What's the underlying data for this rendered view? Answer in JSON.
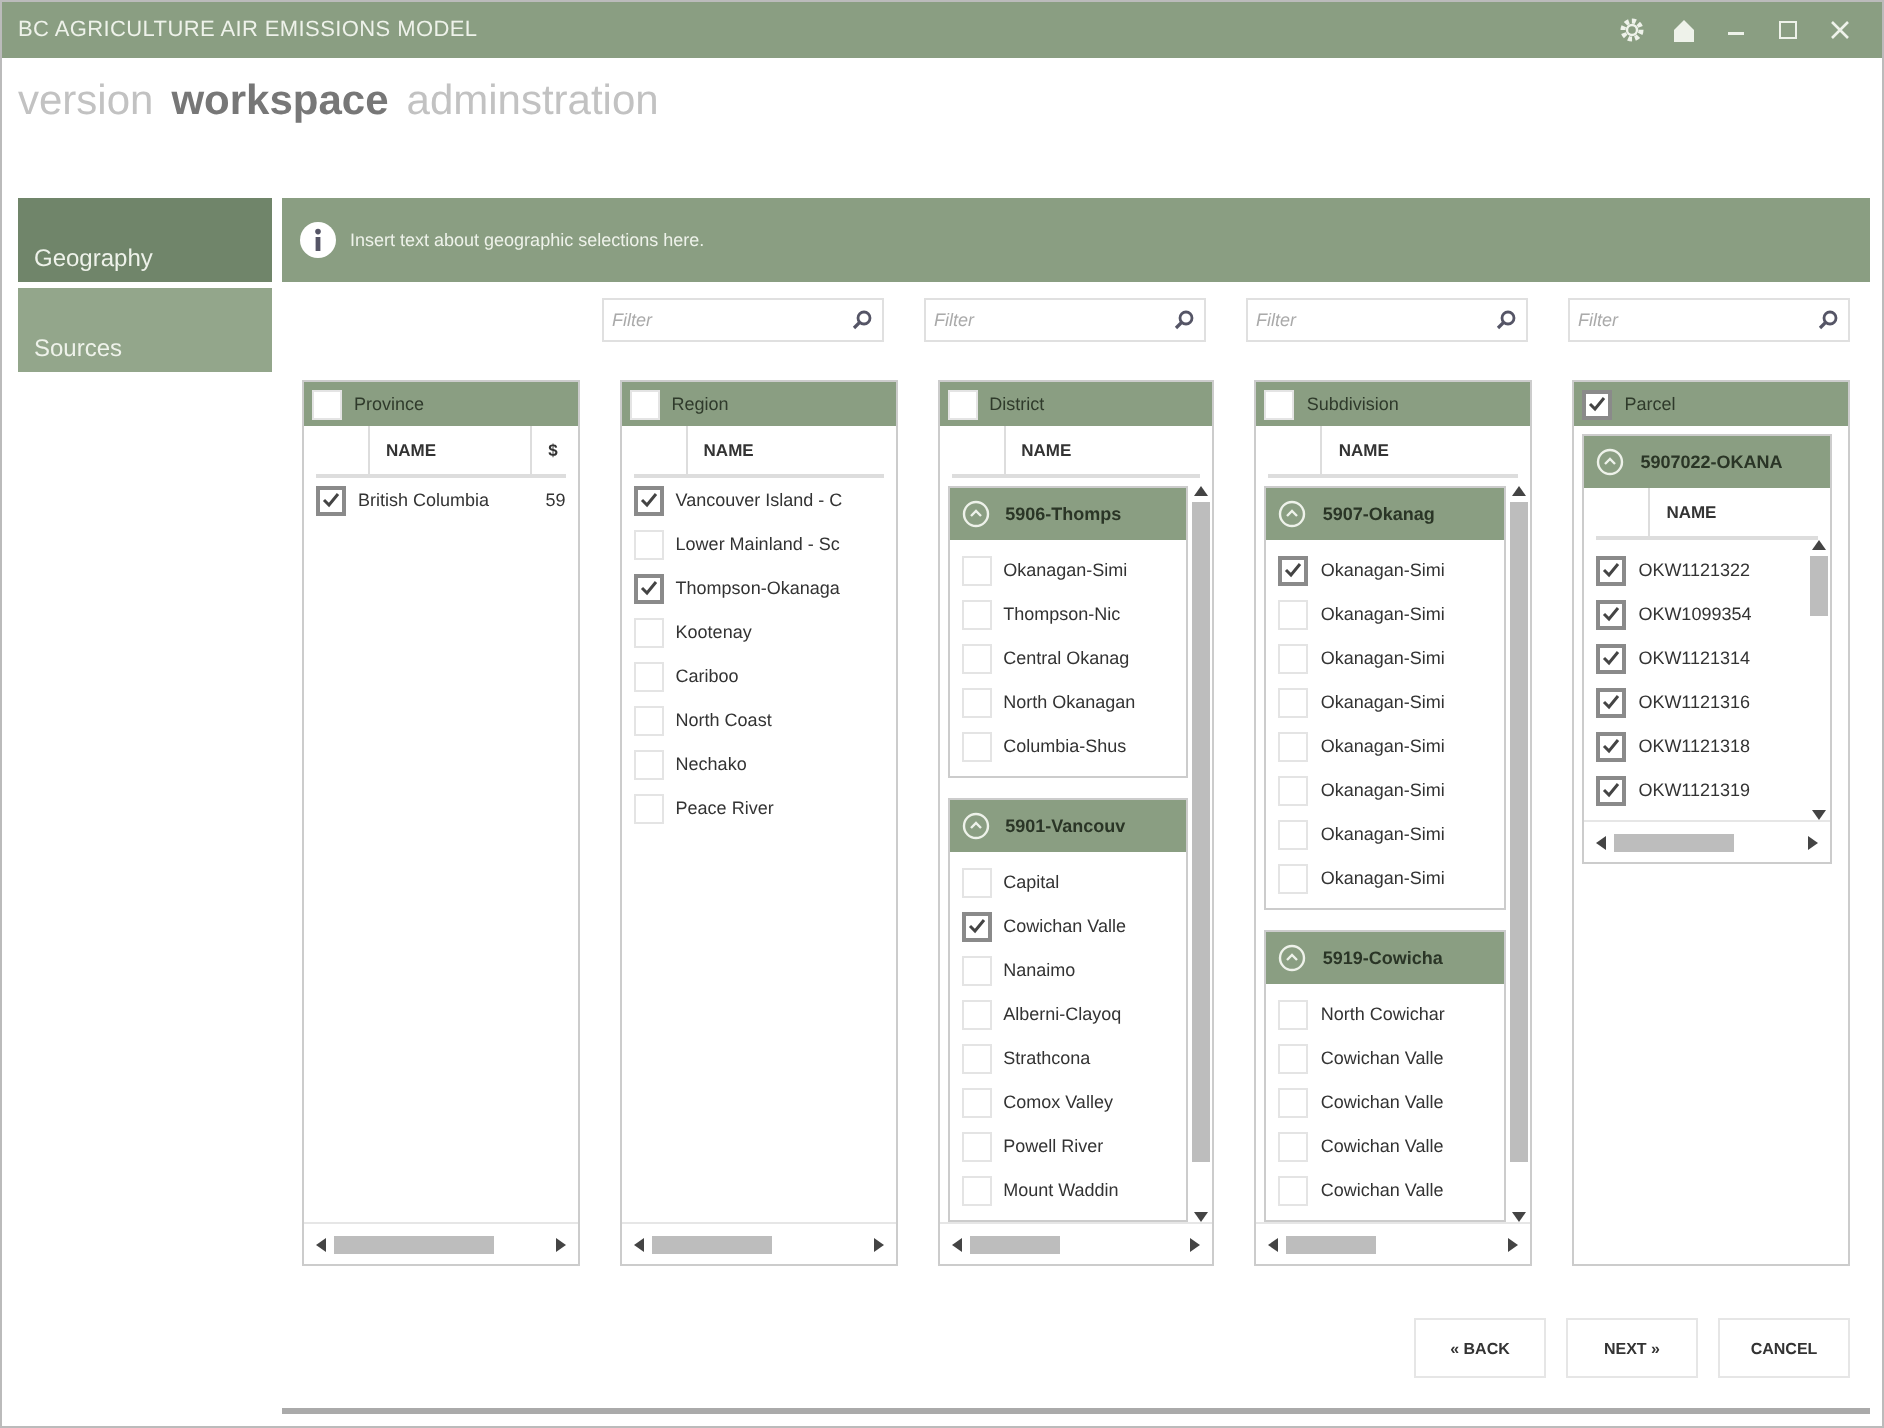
{
  "window": {
    "title": "BC AGRICULTURE AIR EMISSIONS MODEL"
  },
  "nav": [
    {
      "label": "version",
      "selected": false
    },
    {
      "label": "workspace",
      "selected": true
    },
    {
      "label": "adminstration",
      "selected": false
    }
  ],
  "sidebar": {
    "items": [
      {
        "label": "Geography",
        "selected": true
      },
      {
        "label": "Sources",
        "selected": false
      }
    ]
  },
  "info": {
    "text": "Insert text about geographic selections here."
  },
  "columns": [
    {
      "kind": "flat",
      "header": {
        "label": "Province",
        "checked": false
      },
      "name_headers": [
        "NAME",
        "$"
      ],
      "rows": [
        {
          "cells": [
            "British Columbia",
            "59"
          ],
          "checked": true
        }
      ]
    },
    {
      "kind": "flat",
      "header": {
        "label": "Region",
        "checked": false
      },
      "filter": {
        "placeholder": "Filter"
      },
      "name_headers": [
        "NAME"
      ],
      "rows": [
        {
          "cells": [
            "Vancouver Island - C"
          ],
          "checked": true
        },
        {
          "cells": [
            "Lower Mainland - Sc"
          ],
          "checked": false
        },
        {
          "cells": [
            "Thompson-Okanaga"
          ],
          "checked": true
        },
        {
          "cells": [
            "Kootenay"
          ],
          "checked": false
        },
        {
          "cells": [
            "Cariboo"
          ],
          "checked": false
        },
        {
          "cells": [
            "North Coast"
          ],
          "checked": false
        },
        {
          "cells": [
            "Nechako"
          ],
          "checked": false
        },
        {
          "cells": [
            "Peace River"
          ],
          "checked": false
        }
      ]
    },
    {
      "kind": "grouped",
      "header": {
        "label": "District",
        "checked": false
      },
      "filter": {
        "placeholder": "Filter"
      },
      "name_headers": [
        "NAME"
      ],
      "groups": [
        {
          "title": "5906-Thomps",
          "expanded": true,
          "rows": [
            {
              "cells": [
                "Okanagan-Simi"
              ],
              "checked": false
            },
            {
              "cells": [
                "Thompson-Nic"
              ],
              "checked": false
            },
            {
              "cells": [
                "Central Okanag"
              ],
              "checked": false
            },
            {
              "cells": [
                "North Okanagan"
              ],
              "checked": false
            },
            {
              "cells": [
                "Columbia-Shus"
              ],
              "checked": false
            }
          ]
        },
        {
          "title": "5901-Vancouv",
          "expanded": true,
          "rows": [
            {
              "cells": [
                "Capital"
              ],
              "checked": false
            },
            {
              "cells": [
                "Cowichan Valle"
              ],
              "checked": true
            },
            {
              "cells": [
                "Nanaimo"
              ],
              "checked": false
            },
            {
              "cells": [
                "Alberni-Clayoq"
              ],
              "checked": false
            },
            {
              "cells": [
                "Strathcona"
              ],
              "checked": false
            },
            {
              "cells": [
                "Comox Valley"
              ],
              "checked": false
            },
            {
              "cells": [
                "Powell River"
              ],
              "checked": false
            },
            {
              "cells": [
                "Mount Waddin"
              ],
              "checked": false
            }
          ]
        }
      ]
    },
    {
      "kind": "grouped",
      "header": {
        "label": "Subdivision",
        "checked": false
      },
      "filter": {
        "placeholder": "Filter"
      },
      "name_headers": [
        "NAME"
      ],
      "groups": [
        {
          "title": "5907-Okanag",
          "expanded": true,
          "rows": [
            {
              "cells": [
                "Okanagan-Simi"
              ],
              "checked": true
            },
            {
              "cells": [
                "Okanagan-Simi"
              ],
              "checked": false
            },
            {
              "cells": [
                "Okanagan-Simi"
              ],
              "checked": false
            },
            {
              "cells": [
                "Okanagan-Simi"
              ],
              "checked": false
            },
            {
              "cells": [
                "Okanagan-Simi"
              ],
              "checked": false
            },
            {
              "cells": [
                "Okanagan-Simi"
              ],
              "checked": false
            },
            {
              "cells": [
                "Okanagan-Simi"
              ],
              "checked": false
            },
            {
              "cells": [
                "Okanagan-Simi"
              ],
              "checked": false
            }
          ]
        },
        {
          "title": "5919-Cowicha",
          "expanded": true,
          "rows": [
            {
              "cells": [
                "North Cowichar"
              ],
              "checked": false
            },
            {
              "cells": [
                "Cowichan Valle"
              ],
              "checked": false
            },
            {
              "cells": [
                "Cowichan Valle"
              ],
              "checked": false
            },
            {
              "cells": [
                "Cowichan Valle"
              ],
              "checked": false
            },
            {
              "cells": [
                "Cowichan Valle"
              ],
              "checked": false
            }
          ]
        }
      ]
    },
    {
      "kind": "grouped",
      "header": {
        "label": "Parcel",
        "checked": true
      },
      "filter": {
        "placeholder": "Filter"
      },
      "groups": [
        {
          "title": "5907022-OKANA",
          "expanded": true,
          "name_headers": [
            "NAME"
          ],
          "rows": [
            {
              "cells": [
                "OKW1121322"
              ],
              "checked": true
            },
            {
              "cells": [
                "OKW1099354"
              ],
              "checked": true
            },
            {
              "cells": [
                "OKW1121314"
              ],
              "checked": true
            },
            {
              "cells": [
                "OKW1121316"
              ],
              "checked": true
            },
            {
              "cells": [
                "OKW1121318"
              ],
              "checked": true
            },
            {
              "cells": [
                "OKW1121319"
              ],
              "checked": true
            }
          ]
        }
      ]
    }
  ],
  "buttons": [
    {
      "label": "« BACK"
    },
    {
      "label": "NEXT »"
    },
    {
      "label": "CANCEL"
    }
  ]
}
